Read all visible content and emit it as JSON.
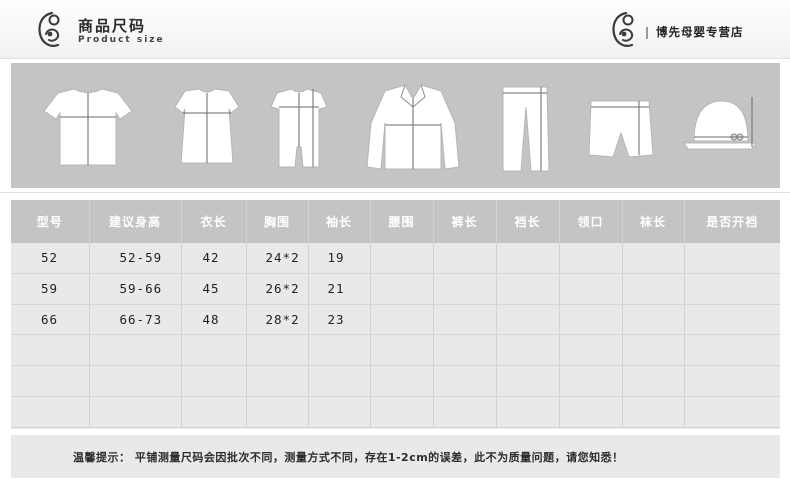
{
  "header": {
    "title_cn": "商品尺码",
    "title_en": "Product size",
    "store_name": "博先母婴专营店",
    "logo_icon": "mother-baby-logo-icon"
  },
  "garment_icons": [
    "tshirt-icon",
    "dress-icon",
    "romper-icon",
    "jacket-icon",
    "pants-icon",
    "shorts-icon",
    "hat-icon"
  ],
  "table": {
    "headers": [
      "型号",
      "建议身高",
      "衣长",
      "胸围",
      "袖长",
      "腰围",
      "裤长",
      "裆长",
      "领口",
      "袜长",
      "是否开裆"
    ],
    "rows": [
      [
        "52",
        "52-59",
        "42",
        "24*2",
        "19",
        "",
        "",
        "",
        "",
        "",
        ""
      ],
      [
        "59",
        "59-66",
        "45",
        "26*2",
        "21",
        "",
        "",
        "",
        "",
        "",
        ""
      ],
      [
        "66",
        "66-73",
        "48",
        "28*2",
        "23",
        "",
        "",
        "",
        "",
        "",
        ""
      ],
      [
        "",
        "",
        "",
        "",
        "",
        "",
        "",
        "",
        "",
        "",
        ""
      ],
      [
        "",
        "",
        "",
        "",
        "",
        "",
        "",
        "",
        "",
        "",
        ""
      ],
      [
        "",
        "",
        "",
        "",
        "",
        "",
        "",
        "",
        "",
        "",
        ""
      ]
    ]
  },
  "notice": "温馨提示：  平铺测量尺码会因批次不同，测量方式不同，存在1-2cm的误差，此不为质量问题，请您知悉！",
  "colors": {
    "panel_gray": "#c4c4c4",
    "table_bg": "#e9e9e9",
    "header_text": "#ffffff"
  }
}
